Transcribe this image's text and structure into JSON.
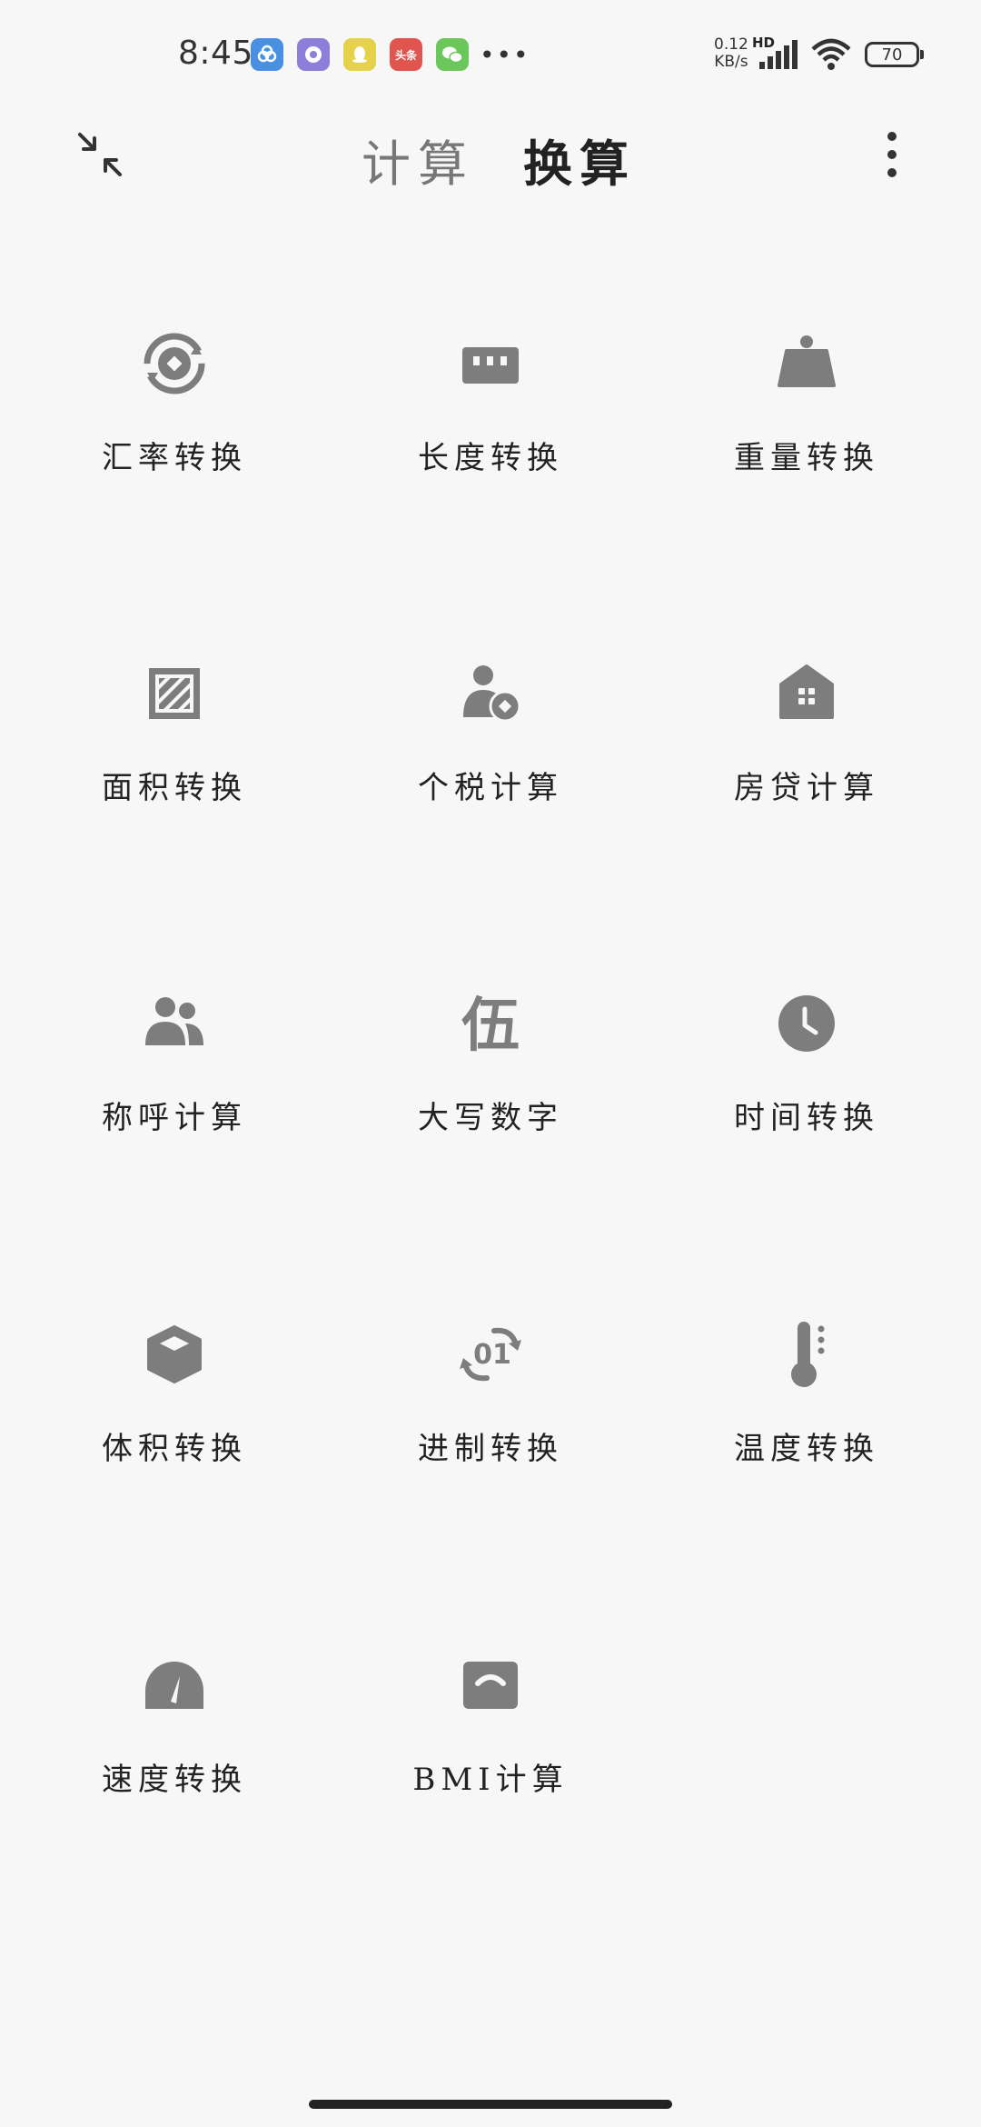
{
  "status_bar": {
    "time": "8:45",
    "more": "•••",
    "net_speed_value": "0.12",
    "net_speed_unit": "KB/s",
    "network_type": "HD",
    "battery": "70",
    "notification_icons": [
      {
        "name": "baidu-netdisk-icon",
        "color": "#4a90e2",
        "label": ""
      },
      {
        "name": "browser-icon",
        "color": "#8b7fd9",
        "label": ""
      },
      {
        "name": "qq-icon",
        "color": "#e6d14a",
        "label": ""
      },
      {
        "name": "toutiao-icon",
        "color": "#e0554f",
        "label": "头条"
      },
      {
        "name": "wechat-icon",
        "color": "#6cc75a",
        "label": ""
      }
    ]
  },
  "header": {
    "tab_calc": "计算",
    "tab_convert": "换算"
  },
  "tools": [
    {
      "label": "汇率转换",
      "icon": "currency-exchange-icon"
    },
    {
      "label": "长度转换",
      "icon": "ruler-icon"
    },
    {
      "label": "重量转换",
      "icon": "weight-icon"
    },
    {
      "label": "面积转换",
      "icon": "area-icon"
    },
    {
      "label": "个税计算",
      "icon": "personal-tax-icon"
    },
    {
      "label": "房贷计算",
      "icon": "house-loan-icon"
    },
    {
      "label": "称呼计算",
      "icon": "relatives-icon"
    },
    {
      "label": "大写数字",
      "icon": "capital-number-icon"
    },
    {
      "label": "时间转换",
      "icon": "clock-icon"
    },
    {
      "label": "体积转换",
      "icon": "cube-icon"
    },
    {
      "label": "进制转换",
      "icon": "number-base-icon"
    },
    {
      "label": "温度转换",
      "icon": "thermometer-icon"
    },
    {
      "label": "速度转换",
      "icon": "speedometer-icon"
    },
    {
      "label": "BMI计算",
      "icon": "bmi-scale-icon"
    }
  ],
  "colors": {
    "icon_gray": "#7d7d7d",
    "background": "#f7f7f7"
  },
  "capital_number_glyph": "伍",
  "number_base_glyph": "01"
}
